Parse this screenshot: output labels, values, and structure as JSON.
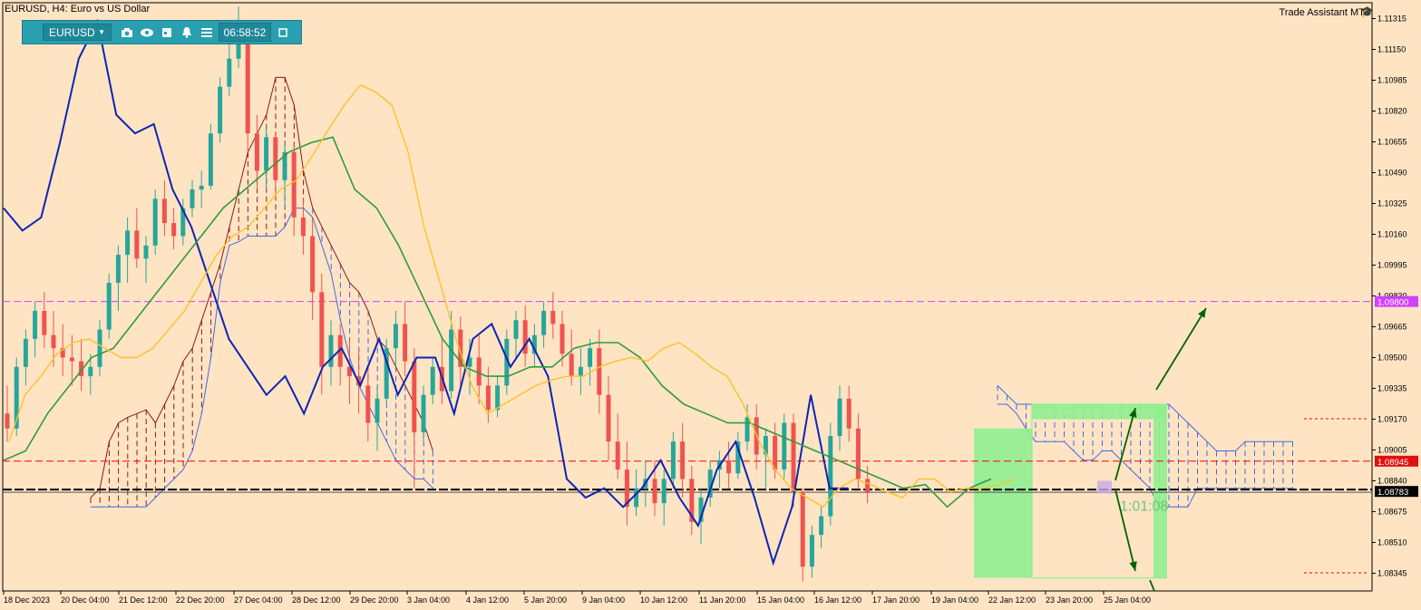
{
  "window": {
    "title": "EURUSD, H4:  Euro vs US Dollar",
    "assistant_label": "Trade Assistant MT5"
  },
  "toolbar": {
    "symbol": "EURUSD",
    "time": "06:58:52"
  },
  "icons": [
    "camera-icon",
    "eye-icon",
    "calendar-icon",
    "bell-icon",
    "menu-icon",
    "window-icon",
    "chevron-down-icon",
    "graduation-cap-icon"
  ],
  "countdown": "1:01:08",
  "colors": {
    "background": "#ffe4c4",
    "bull": "#26a69a",
    "bear": "#ef5350",
    "price_line": "#000000",
    "tenkan": "#ffc125",
    "kijun": "#2e9b3e",
    "chikou": "#0d24b4",
    "cloud_bear": "#8b1a1a",
    "cloud_bull": "#4169e1",
    "level_red": "#ff0000",
    "level_magenta": "#d040ff",
    "zone": "#90ee90",
    "arrow": "#006400"
  },
  "chart_data": {
    "type": "candlestick",
    "symbol": "EURUSD",
    "timeframe": "H4",
    "ylim": [
      1.0825,
      1.114
    ],
    "y_ticks": [
      1.11315,
      1.1115,
      1.10985,
      1.1082,
      1.10655,
      1.1049,
      1.10325,
      1.1016,
      1.09995,
      1.0983,
      1.09665,
      1.095,
      1.09335,
      1.0917,
      1.09005,
      1.0884,
      1.08675,
      1.0851,
      1.08345
    ],
    "y_tick_labels": [
      "1.11315",
      "1.11150",
      "1.10985",
      "1.10820",
      "1.10655",
      "1.10490",
      "1.10325",
      "1.10160",
      "1.09995",
      "1.09830",
      "1.09665",
      "1.09500",
      "1.09335",
      "1.09170",
      "1.09005",
      "1.08840",
      "1.08675",
      "1.08510",
      "1.08345"
    ],
    "x_labels": [
      "18 Dec 2023",
      "20 Dec 04:00",
      "21 Dec 12:00",
      "22 Dec 20:00",
      "27 Dec 04:00",
      "28 Dec 12:00",
      "29 Dec 20:00",
      "3 Jan 04:00",
      "4 Jan 12:00",
      "5 Jan 20:00",
      "9 Jan 04:00",
      "10 Jan 12:00",
      "11 Jan 20:00",
      "15 Jan 04:00",
      "16 Jan 12:00",
      "17 Jan 20:00",
      "19 Jan 04:00",
      "22 Jan 12:00",
      "23 Jan 20:00",
      "25 Jan 04:00"
    ],
    "current_price": 1.08783,
    "current_price_label": "1.08783",
    "levels": [
      {
        "name": "resistance",
        "value": 1.098,
        "label": "1.09800"
      },
      {
        "name": "support",
        "value": 1.08945,
        "label": "1.08945"
      }
    ],
    "candles_ohlc": [
      [
        1.092,
        1.0935,
        1.0905,
        1.0912
      ],
      [
        1.0912,
        1.095,
        1.0908,
        1.0945
      ],
      [
        1.0945,
        1.0965,
        1.0935,
        1.096
      ],
      [
        1.096,
        1.098,
        1.095,
        1.0975
      ],
      [
        1.0975,
        1.0985,
        1.0955,
        1.0962
      ],
      [
        1.0962,
        1.0975,
        1.0945,
        1.0955
      ],
      [
        1.0955,
        1.0968,
        1.094,
        1.095
      ],
      [
        1.095,
        1.0962,
        1.0935,
        1.0948
      ],
      [
        1.0948,
        1.096,
        1.0932,
        1.094
      ],
      [
        1.094,
        1.0952,
        1.093,
        1.0945
      ],
      [
        1.0945,
        1.097,
        1.094,
        1.0965
      ],
      [
        1.0965,
        1.0995,
        1.096,
        1.099
      ],
      [
        1.099,
        1.101,
        1.0975,
        1.1005
      ],
      [
        1.1005,
        1.1025,
        1.099,
        1.1018
      ],
      [
        1.1018,
        1.103,
        1.0998,
        1.1003
      ],
      [
        1.1003,
        1.1015,
        1.099,
        1.101
      ],
      [
        1.101,
        1.104,
        1.1005,
        1.1035
      ],
      [
        1.1035,
        1.1045,
        1.1015,
        1.1022
      ],
      [
        1.1022,
        1.103,
        1.1008,
        1.1015
      ],
      [
        1.1015,
        1.1035,
        1.101,
        1.103
      ],
      [
        1.103,
        1.1045,
        1.1025,
        1.104
      ],
      [
        1.104,
        1.105,
        1.103,
        1.1042
      ],
      [
        1.1042,
        1.1075,
        1.104,
        1.107
      ],
      [
        1.107,
        1.11,
        1.1065,
        1.1095
      ],
      [
        1.1095,
        1.112,
        1.109,
        1.111
      ],
      [
        1.111,
        1.1138,
        1.1105,
        1.112
      ],
      [
        1.112,
        1.113,
        1.106,
        1.107
      ],
      [
        1.107,
        1.108,
        1.104,
        1.105
      ],
      [
        1.105,
        1.1075,
        1.104,
        1.1068
      ],
      [
        1.1068,
        1.107,
        1.1035,
        1.1045
      ],
      [
        1.1045,
        1.1065,
        1.103,
        1.106
      ],
      [
        1.106,
        1.1065,
        1.1015,
        1.1025
      ],
      [
        1.1025,
        1.1035,
        1.1005,
        1.1015
      ],
      [
        1.1015,
        1.1025,
        1.097,
        1.0985
      ],
      [
        1.0985,
        1.0995,
        1.093,
        1.0945
      ],
      [
        1.0945,
        1.097,
        1.0935,
        1.0962
      ],
      [
        1.0962,
        1.0968,
        1.0935,
        1.0945
      ],
      [
        1.0945,
        1.096,
        1.0925,
        1.094
      ],
      [
        1.094,
        1.0955,
        1.092,
        1.0935
      ],
      [
        1.0935,
        1.0945,
        1.0905,
        1.0915
      ],
      [
        1.0915,
        1.0935,
        1.09,
        1.0928
      ],
      [
        1.0928,
        1.096,
        1.0925,
        1.0955
      ],
      [
        1.0955,
        1.0975,
        1.0945,
        1.0968
      ],
      [
        1.0968,
        1.098,
        1.094,
        1.0948
      ],
      [
        1.0948,
        1.0955,
        1.088,
        1.091
      ],
      [
        1.091,
        1.0935,
        1.0905,
        1.093
      ],
      [
        1.093,
        1.095,
        1.0925,
        1.0945
      ],
      [
        1.0945,
        1.096,
        1.0925,
        1.0932
      ],
      [
        1.0932,
        1.0975,
        1.0928,
        1.0965
      ],
      [
        1.0965,
        1.0972,
        1.0935,
        1.0945
      ],
      [
        1.0945,
        1.096,
        1.093,
        1.095
      ],
      [
        1.095,
        1.0962,
        1.0925,
        1.0935
      ],
      [
        1.0935,
        1.0945,
        1.0915,
        1.0922
      ],
      [
        1.0922,
        1.094,
        1.0918,
        1.0935
      ],
      [
        1.0935,
        1.0965,
        1.093,
        1.096
      ],
      [
        1.096,
        1.0975,
        1.095,
        1.097
      ],
      [
        1.097,
        1.0978,
        1.0945,
        1.0952
      ],
      [
        1.0952,
        1.0968,
        1.0945,
        1.0962
      ],
      [
        1.0962,
        1.098,
        1.0955,
        1.0975
      ],
      [
        1.0975,
        1.0985,
        1.096,
        1.0968
      ],
      [
        1.0968,
        1.0975,
        1.0945,
        1.0952
      ],
      [
        1.0952,
        1.0965,
        1.0935,
        1.094
      ],
      [
        1.094,
        1.0955,
        1.093,
        1.0945
      ],
      [
        1.0945,
        1.096,
        1.0935,
        1.0955
      ],
      [
        1.0955,
        1.0965,
        1.092,
        1.093
      ],
      [
        1.093,
        1.094,
        1.0895,
        1.0905
      ],
      [
        1.0905,
        1.092,
        1.0885,
        1.089
      ],
      [
        1.089,
        1.0905,
        1.086,
        1.087
      ],
      [
        1.087,
        1.089,
        1.0865,
        1.088
      ],
      [
        1.088,
        1.0895,
        1.087,
        1.0885
      ],
      [
        1.0885,
        1.0895,
        1.0865,
        1.0872
      ],
      [
        1.0872,
        1.089,
        1.086,
        1.0885
      ],
      [
        1.0885,
        1.091,
        1.088,
        1.0905
      ],
      [
        1.0905,
        1.0915,
        1.0875,
        1.0885
      ],
      [
        1.0885,
        1.0892,
        1.0855,
        1.0862
      ],
      [
        1.0862,
        1.088,
        1.085,
        1.0875
      ],
      [
        1.0875,
        1.0895,
        1.087,
        1.089
      ],
      [
        1.089,
        1.09,
        1.088,
        1.0895
      ],
      [
        1.0895,
        1.0905,
        1.088,
        1.0888
      ],
      [
        1.0888,
        1.091,
        1.0885,
        1.0905
      ],
      [
        1.0905,
        1.0925,
        1.09,
        1.0918
      ],
      [
        1.0918,
        1.0925,
        1.089,
        1.0898
      ],
      [
        1.0898,
        1.0912,
        1.088,
        1.0908
      ],
      [
        1.0908,
        1.0915,
        1.0885,
        1.089
      ],
      [
        1.089,
        1.092,
        1.0885,
        1.0915
      ],
      [
        1.0915,
        1.092,
        1.087,
        1.0878
      ],
      [
        1.0878,
        1.088,
        1.083,
        1.0838
      ],
      [
        1.0838,
        1.086,
        1.0832,
        1.0855
      ],
      [
        1.0855,
        1.087,
        1.0848,
        1.0865
      ],
      [
        1.0865,
        1.0915,
        1.086,
        1.0908
      ],
      [
        1.0908,
        1.0935,
        1.09,
        1.0928
      ],
      [
        1.0928,
        1.0935,
        1.0905,
        1.0912
      ],
      [
        1.0912,
        1.092,
        1.088,
        1.0885
      ],
      [
        1.0885,
        1.0892,
        1.0872,
        1.0878
      ]
    ],
    "tenkan_sen": [
      1.0905,
      1.093,
      1.094,
      1.0952,
      1.0958,
      1.096,
      1.0955,
      1.095,
      1.095,
      1.0955,
      1.0965,
      1.0975,
      1.099,
      1.1005,
      1.1015,
      1.102,
      1.103,
      1.104,
      1.1045,
      1.1058,
      1.1072,
      1.1085,
      1.1096,
      1.1092,
      1.1085,
      1.106,
      1.102,
      1.099,
      1.096,
      1.0935,
      1.092,
      1.0925,
      1.093,
      1.0935,
      1.0938,
      1.094,
      1.094,
      1.0945,
      1.0948,
      1.095,
      1.0948,
      1.0955,
      1.0958,
      1.0952,
      1.0945,
      1.094,
      1.0925,
      1.0905,
      1.089,
      1.088,
      1.0875,
      1.087,
      1.088,
      1.0885,
      1.0882,
      1.0878,
      1.0875,
      1.0885,
      1.0885,
      1.0878,
      1.088,
      1.088,
      1.0882,
      1.0885
    ],
    "kijun_sen": [
      1.0895,
      1.09,
      1.092,
      1.0935,
      1.095,
      1.0955,
      1.097,
      1.0985,
      1.1,
      1.1015,
      1.103,
      1.104,
      1.105,
      1.106,
      1.1065,
      1.1068,
      1.104,
      1.103,
      1.101,
      1.0985,
      1.096,
      1.0945,
      1.094,
      1.094,
      1.0945,
      1.0945,
      1.0955,
      1.0958,
      1.0958,
      1.095,
      1.0935,
      1.0925,
      1.092,
      1.0915,
      1.0915,
      1.091,
      1.0905,
      1.09,
      1.0895,
      1.089,
      1.0885,
      1.088,
      1.0882,
      1.087,
      1.088,
      1.0885
    ],
    "chikou_span": [
      1.103,
      1.1018,
      1.1025,
      1.1065,
      1.111,
      1.113,
      1.108,
      1.107,
      1.1075,
      1.104,
      1.102,
      1.099,
      1.096,
      1.0945,
      1.093,
      1.094,
      1.092,
      1.0945,
      1.0955,
      1.0935,
      1.096,
      1.093,
      1.095,
      1.095,
      1.092,
      1.096,
      1.0968,
      1.0945,
      1.096,
      1.094,
      1.0885,
      1.0875,
      1.088,
      1.087,
      1.088,
      1.0895,
      1.0875,
      1.086,
      1.089,
      1.0905,
      1.0875,
      1.084,
      1.087,
      1.093,
      1.088,
      1.088
    ]
  }
}
